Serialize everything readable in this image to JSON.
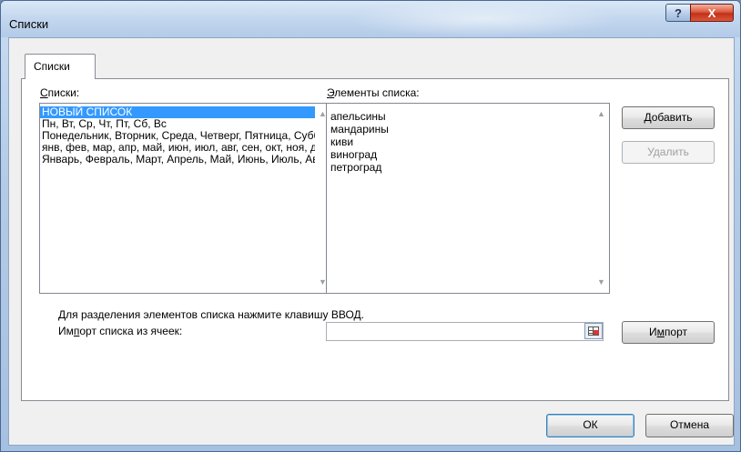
{
  "window": {
    "title": "Списки"
  },
  "titlebar": {
    "help_glyph": "?",
    "close_glyph": "X"
  },
  "tab": {
    "label": "Списки"
  },
  "lists_label": {
    "hotkey": "С",
    "rest": "писки:"
  },
  "lists": [
    "НОВЫЙ СПИСОК",
    "Пн, Вт, Ср, Чт, Пт, Сб, Вс",
    "Понедельник, Вторник, Среда, Четверг, Пятница, Суббота, Воскресенье",
    "янв, фев, мар, апр, май, июн, июл, авг, сен, окт, ноя, дек",
    "Январь, Февраль, Март, Апрель, Май, Июнь, Июль, Август, Сентябрь, Октябрь, Ноябрь, Декабрь"
  ],
  "selected_list_index": 0,
  "entries_label": {
    "hotkey": "Э",
    "rest": "лементы списка:"
  },
  "entries": [
    "апельсины",
    "мандарины",
    "киви",
    "виноград",
    "петроград"
  ],
  "buttons": {
    "add": {
      "hotkey": "Д",
      "rest": "обавить"
    },
    "delete": "Удалить",
    "import": {
      "pre": "И",
      "hotkey": "м",
      "rest": "порт"
    },
    "ok": "ОК",
    "cancel": "Отмена"
  },
  "hint": "Для разделения элементов списка нажмите клавишу ВВОД.",
  "import_label": {
    "pre": "Им",
    "hotkey": "п",
    "rest": "орт списка из ячеек:"
  },
  "import_field": {
    "value": ""
  },
  "scroll": {
    "up": "▲",
    "down": "▼"
  }
}
